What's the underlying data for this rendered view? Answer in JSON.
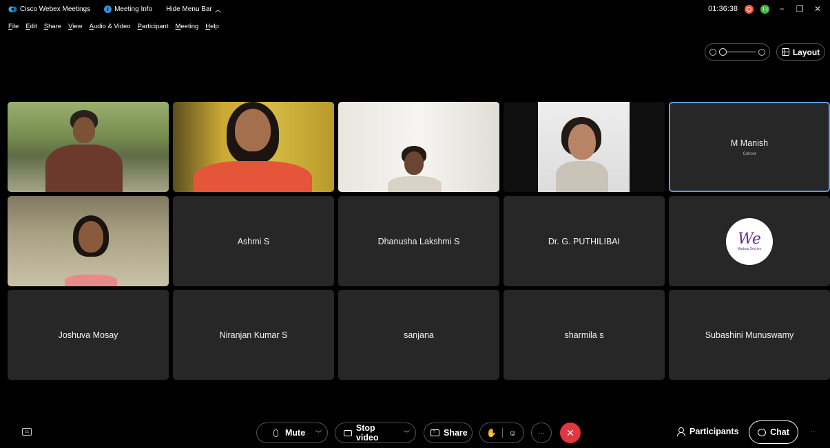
{
  "titlebar": {
    "app_name": "Cisco Webex Meetings",
    "meeting_info": "Meeting Info",
    "hide_menu": "Hide Menu Bar",
    "time": "01:36:38"
  },
  "menu": [
    "File",
    "Edit",
    "Share",
    "View",
    "Audio & Video",
    "Participant",
    "Meeting",
    "Help"
  ],
  "layout_button": "Layout",
  "tiles": {
    "manish": {
      "name": "M Manish",
      "role": "Cohost"
    },
    "ashmi": "Ashmi S",
    "dhanusha": "Dhanusha Lakshmi S",
    "puthilibai": "Dr. G. PUTHILIBAI",
    "joshuva": "Joshuva Mosay",
    "niranjan": "Niranjan Kumar S",
    "sanjana": "sanjana",
    "sharmila": "sharmila s",
    "subashini": "Subashini Munuswamy",
    "logo": {
      "text": "We",
      "section": "Madras Section"
    }
  },
  "toolbar": {
    "mute": "Mute",
    "stop_video": "Stop video",
    "share": "Share",
    "participants": "Participants",
    "chat": "Chat"
  },
  "colors": {
    "accent": "#5a9ee0",
    "end_call": "#e3363e",
    "tile_bg": "#272727",
    "mic": "#e8c840"
  }
}
